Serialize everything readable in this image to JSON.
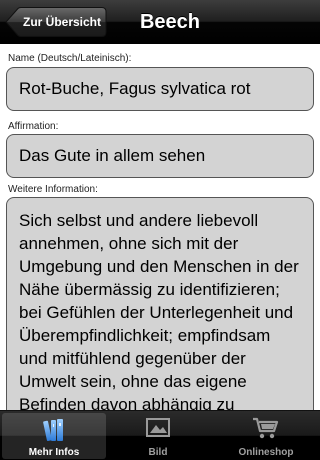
{
  "navbar": {
    "back_label": "Zur Übersicht",
    "title": "Beech"
  },
  "fields": {
    "name_label": "Name (Deutsch/Lateinisch):",
    "name_value": "Rot-Buche, Fagus sylvatica rot",
    "affirmation_label": "Affirmation:",
    "affirmation_value": "Das Gute in allem sehen",
    "info_label": "Weitere Information:",
    "info_value": "Sich selbst und andere liebevoll annehmen, ohne sich mit der Umgebung und den Menschen in der Nähe übermässig zu identifizieren; bei Gefühlen der Unterlegenheit und Überempfindlichkeit; empfindsam und mitfühlend gegenüber der Umwelt sein, ohne das eigene Befinden davon abhängig zu machen."
  },
  "tabbar": {
    "tabs": [
      {
        "label": "Mehr Infos",
        "icon": "books-icon",
        "selected": true
      },
      {
        "label": "Bild",
        "icon": "picture-icon",
        "selected": false
      },
      {
        "label": "Onlineshop",
        "icon": "cart-icon",
        "selected": false
      }
    ]
  },
  "colors": {
    "field_background": "#d3d3d3",
    "field_border": "#555555",
    "bar_background": "#000000",
    "active_icon": "#5aa0ea"
  }
}
